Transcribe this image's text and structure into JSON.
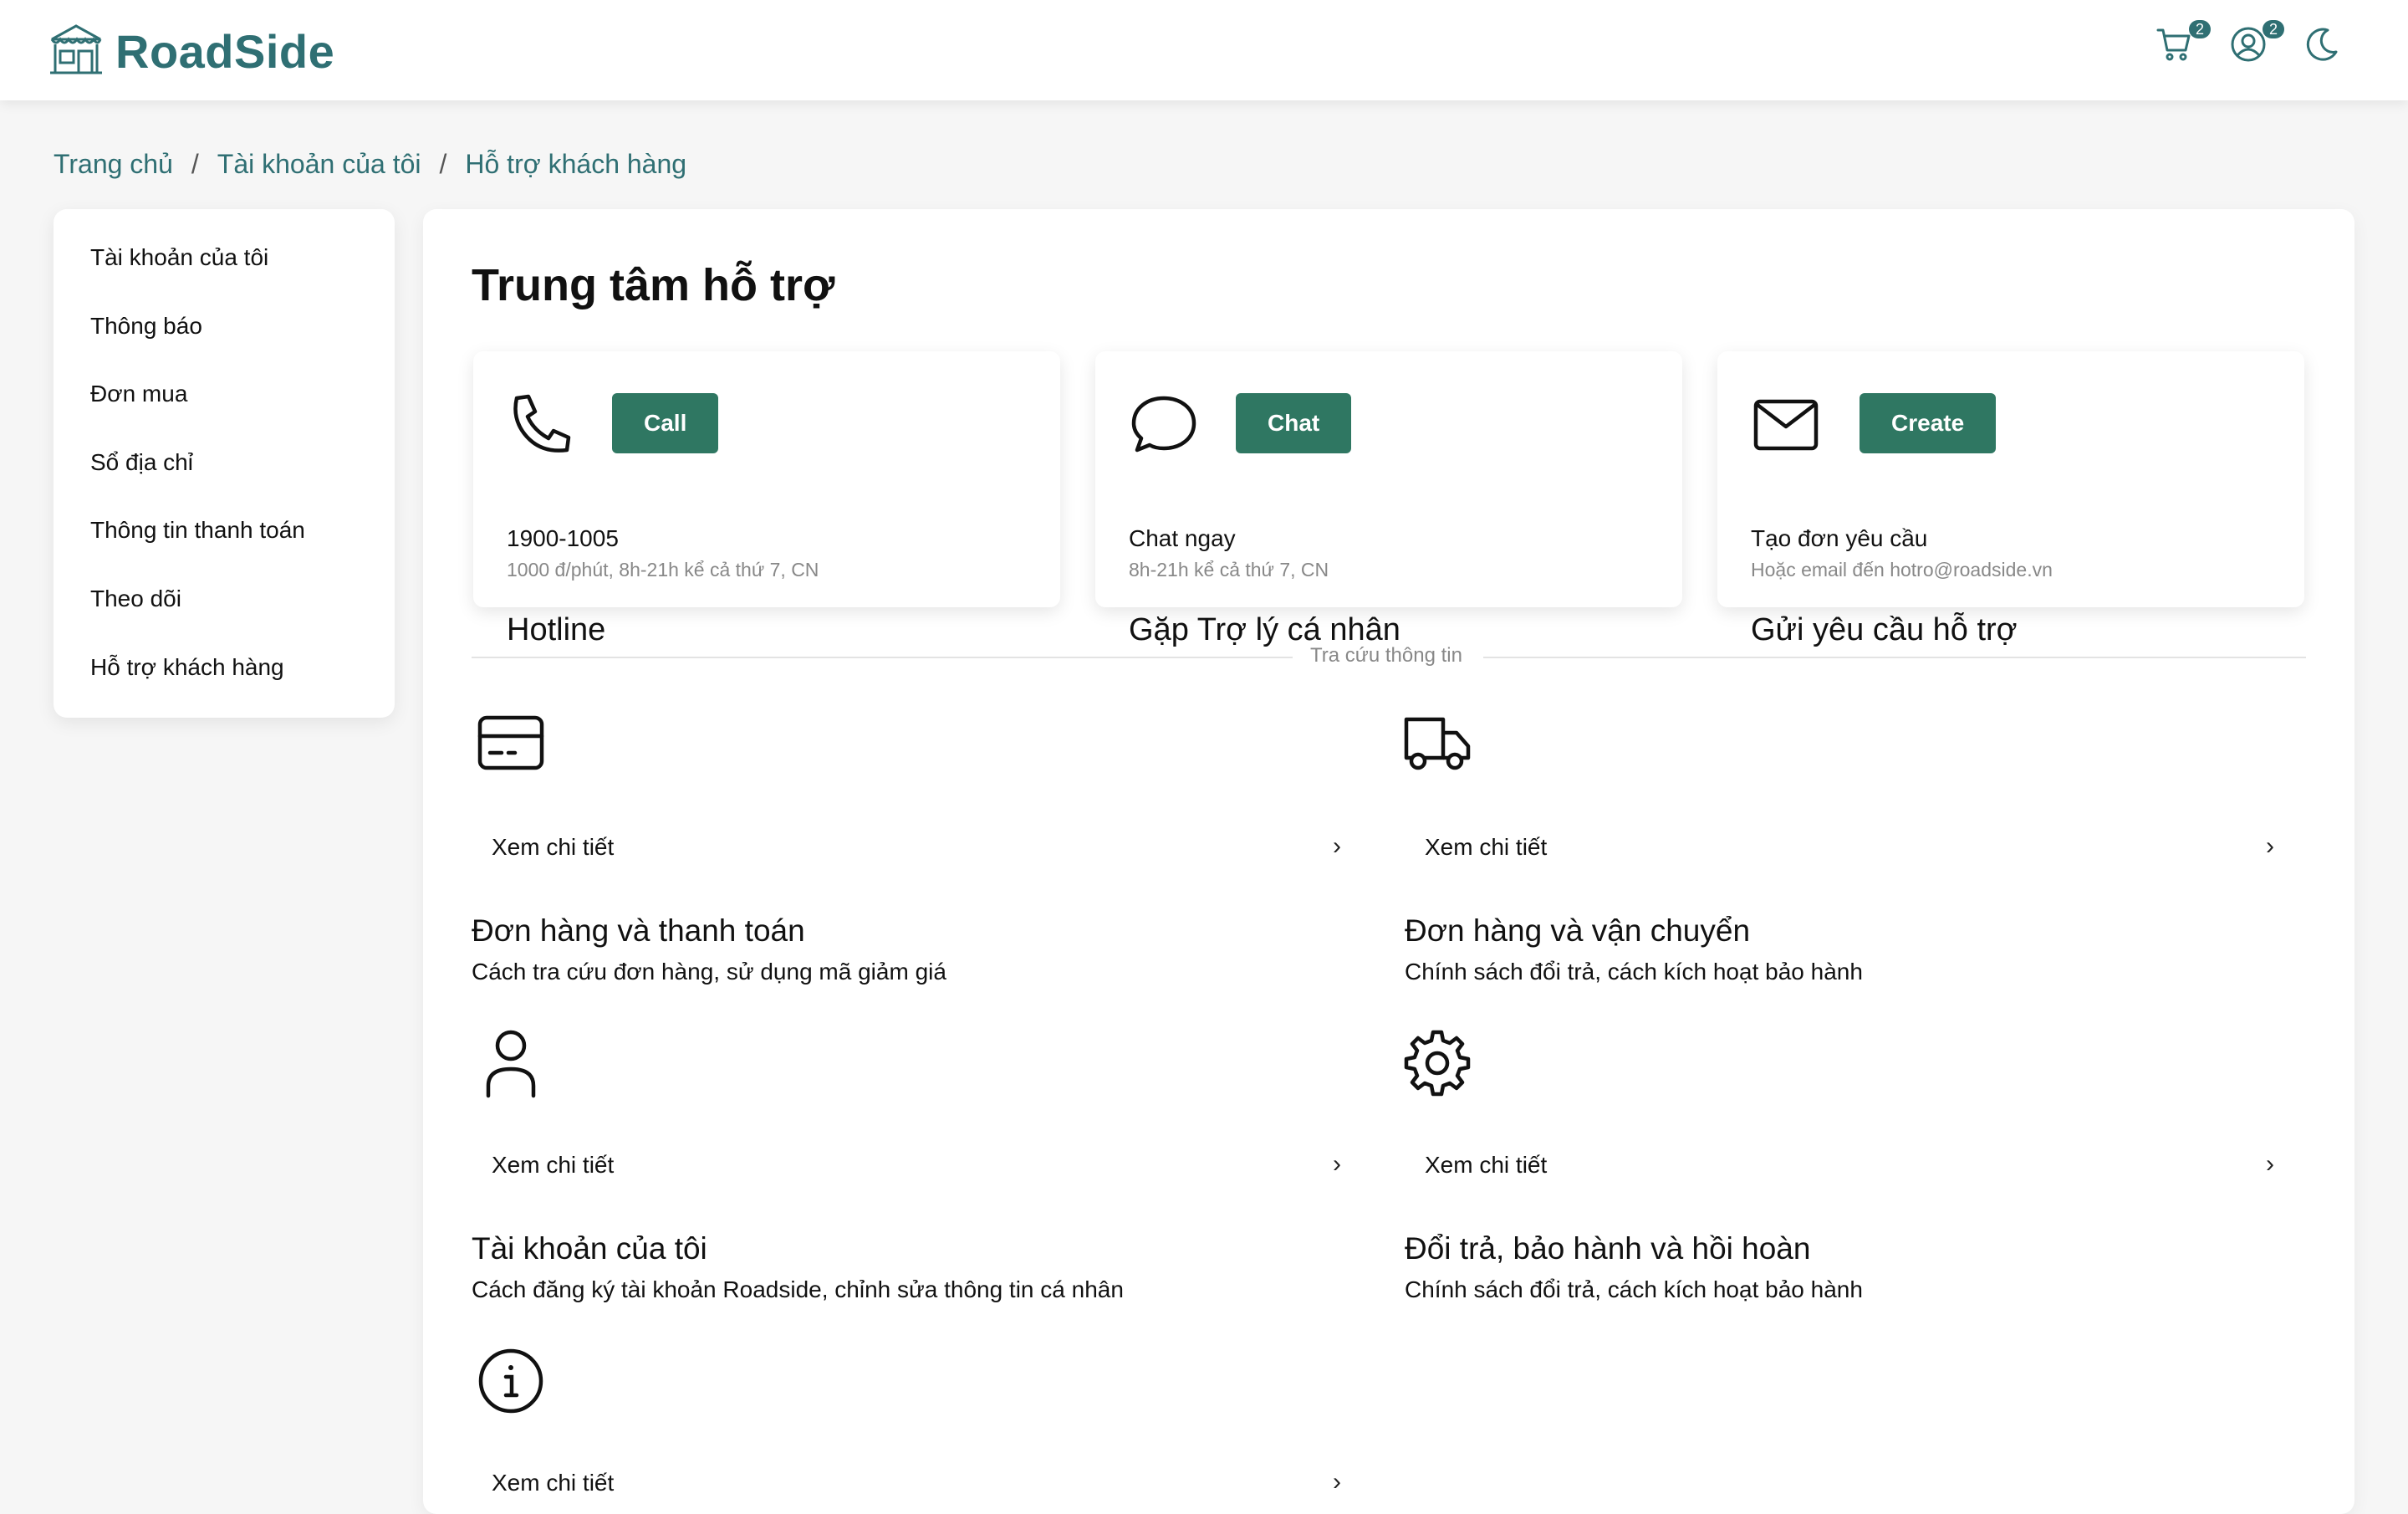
{
  "brand": {
    "name": "RoadSide",
    "color": "#2f6f73",
    "accent_button": "#2f7762"
  },
  "header": {
    "cart_badge": "2",
    "user_badge": "2",
    "icons": [
      "cart-icon",
      "user-icon",
      "moon-icon"
    ]
  },
  "breadcrumb": {
    "items": [
      "Trang chủ",
      "Tài khoản của tôi",
      "Hỗ trợ khách hàng"
    ],
    "separator": "/"
  },
  "sidebar": {
    "items": [
      "Tài khoản của tôi",
      "Thông báo",
      "Đơn mua",
      "Sổ địa chỉ",
      "Thông tin thanh toán",
      "Theo dõi",
      "Hỗ trợ khách hàng"
    ]
  },
  "main": {
    "title": "Trung tâm hỗ trợ",
    "cards": [
      {
        "icon": "phone-icon",
        "button": "Call",
        "title": "Hotline",
        "subtitle": "1900-1005",
        "note": "1000 đ/phút, 8h-21h kể cả thứ 7, CN"
      },
      {
        "icon": "chat-bubble-icon",
        "button": "Chat",
        "title": "Gặp Trợ lý cá nhân",
        "subtitle": "Chat ngay",
        "note": "8h-21h kể cả thứ 7, CN"
      },
      {
        "icon": "envelope-icon",
        "button": "Create",
        "title": "Gửi yêu cầu hỗ trợ",
        "subtitle": "Tạo đơn yêu cầu",
        "note": "Hoặc email đến hotro@roadside.vn"
      }
    ],
    "divider_label": "Tra cứu thông tin",
    "topics": [
      {
        "icon": "credit-card-icon",
        "link": "Xem chi tiết",
        "title": "Đơn hàng và thanh toán",
        "desc": "Cách tra cứu đơn hàng, sử dụng mã giảm giá"
      },
      {
        "icon": "truck-icon",
        "link": "Xem chi tiết",
        "title": "Đơn hàng và vận chuyển",
        "desc": "Chính sách đổi trả, cách kích hoạt bảo hành"
      },
      {
        "icon": "user-outline-icon",
        "link": "Xem chi tiết",
        "title": "Tài khoản của tôi",
        "desc": "Cách đăng ký tài khoản Roadside, chỉnh sửa thông tin cá nhân"
      },
      {
        "icon": "gear-icon",
        "link": "Xem chi tiết",
        "title": "Đổi trả, bảo hành và hồi hoàn",
        "desc": "Chính sách đổi trả, cách kích hoạt bảo hành"
      },
      {
        "icon": "info-icon",
        "link": "Xem chi tiết",
        "title": "",
        "desc": ""
      }
    ]
  }
}
